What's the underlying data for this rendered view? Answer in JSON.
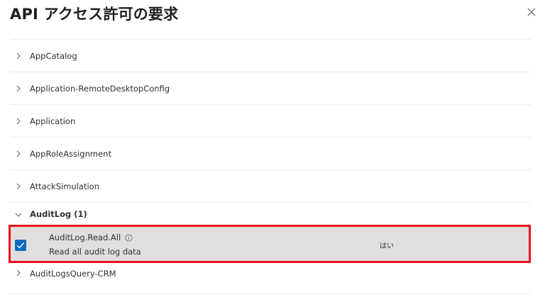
{
  "dialog": {
    "title": "API アクセス許可の要求",
    "close_icon": "close-icon"
  },
  "groups": [
    {
      "label": "AppCatalog",
      "icon": "chevron-right-icon"
    },
    {
      "label": "Application-RemoteDesktopConfig",
      "icon": "chevron-right-icon"
    },
    {
      "label": "Application",
      "icon": "chevron-right-icon"
    },
    {
      "label": "AppRoleAssignment",
      "icon": "chevron-right-icon"
    },
    {
      "label": "AttackSimulation",
      "icon": "chevron-right-icon"
    }
  ],
  "expanded_group": {
    "label": "AuditLog (1)",
    "icon": "chevron-down-icon",
    "permission": {
      "name": "AuditLog.Read.All",
      "description": "Read all audit log data",
      "admin_consent": "はい",
      "checked": true,
      "info_icon": "info-icon",
      "highlight_color": "#e81123",
      "checkbox_color": "#0f6cbd"
    }
  },
  "after_groups": [
    {
      "label": "AuditLogsQuery-CRM",
      "icon": "chevron-right-icon"
    }
  ]
}
